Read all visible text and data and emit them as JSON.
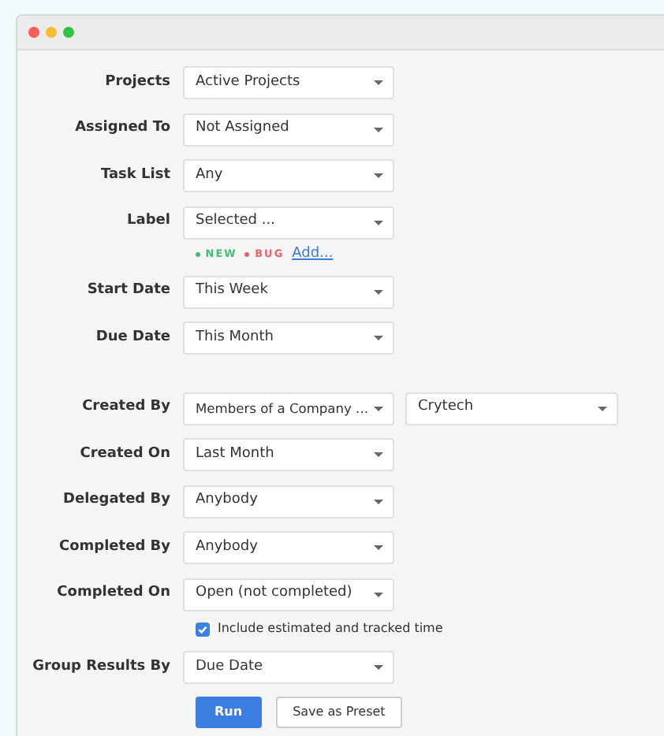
{
  "groups": [
    [
      {
        "label": "Projects",
        "selects": [
          "Active Projects"
        ]
      },
      {
        "label": "Assigned To",
        "selects": [
          "Not Assigned"
        ]
      },
      {
        "label": "Task List",
        "selects": [
          "Any"
        ]
      },
      {
        "label": "Label",
        "selects": [
          "Selected ..."
        ],
        "tags": [
          {
            "text": "NEW",
            "color": "#3fbf6f"
          },
          {
            "text": "BUG",
            "color": "#e8636b"
          }
        ],
        "link": "Add..."
      },
      {
        "label": "Start Date",
        "selects": [
          "This Week"
        ]
      },
      {
        "label": "Due Date",
        "selects": [
          "This Month"
        ]
      }
    ],
    [
      {
        "label": "Created By",
        "selects": [
          "Members of a Company ...",
          "Crytech"
        ]
      },
      {
        "label": "Created On",
        "selects": [
          "Last Month"
        ]
      },
      {
        "label": "Delegated By",
        "selects": [
          "Anybody"
        ]
      },
      {
        "label": "Completed By",
        "selects": [
          "Anybody"
        ]
      },
      {
        "label": "Completed On",
        "selects": [
          "Open (not completed)"
        ],
        "checkbox": {
          "text": "Include estimated and tracked time",
          "checked": true
        }
      },
      {
        "label": "Group Results By",
        "selects": [
          "Due Date"
        ]
      }
    ]
  ],
  "buttons": [
    {
      "text": "Run",
      "kind": "primary"
    },
    {
      "text": "Save as Preset",
      "kind": "secondary"
    }
  ]
}
